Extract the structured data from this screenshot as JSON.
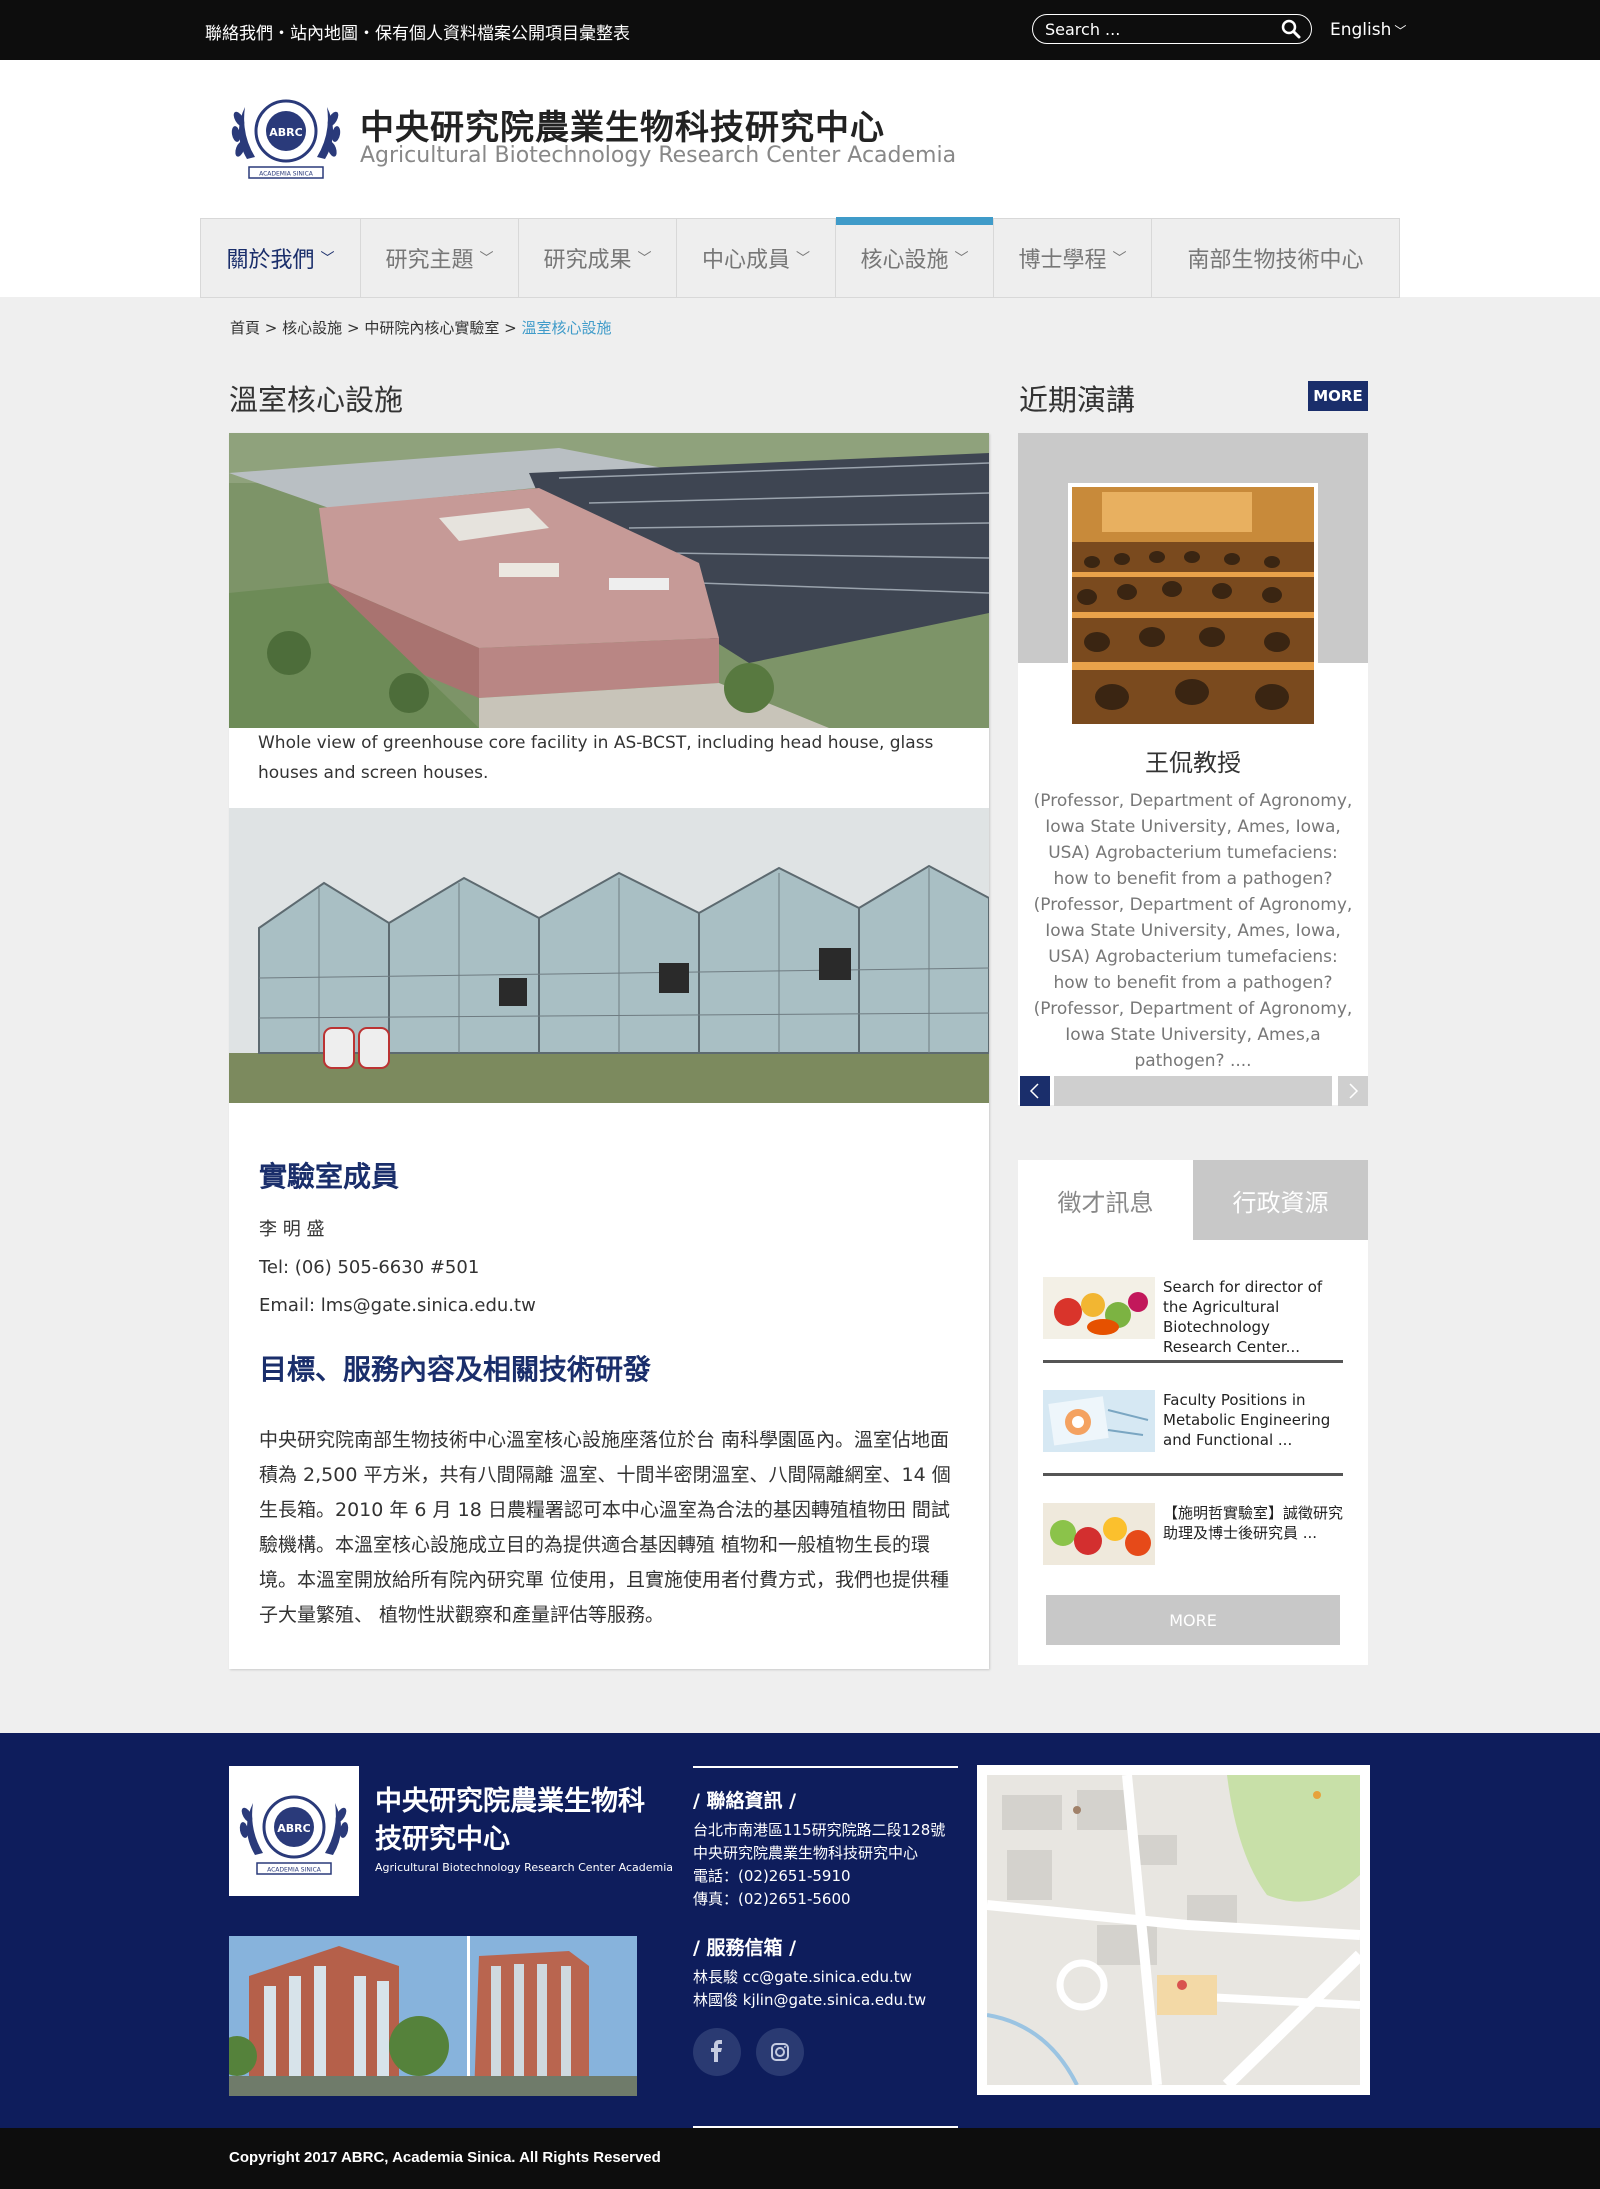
{
  "topbar": {
    "links": [
      "聯絡我們",
      "站內地圖",
      "保有個人資料檔案公開項目彙整表"
    ],
    "separator": "・",
    "search_placeholder": "Search ...",
    "language": "English"
  },
  "header": {
    "title_zh": "中央研究院農業生物科技研究中心",
    "title_en": "Agricultural Biotechnology Research Center Academia",
    "emblem_text": "ABRC",
    "emblem_ribbon": "ACADEMIA SINICA"
  },
  "nav": {
    "items": [
      {
        "label": "關於我們"
      },
      {
        "label": "研究主題"
      },
      {
        "label": "研究成果"
      },
      {
        "label": "中心成員"
      },
      {
        "label": "核心設施"
      },
      {
        "label": "博士學程"
      },
      {
        "label": "南部生物技術中心"
      }
    ],
    "chevron": "﹀"
  },
  "breadcrumb": {
    "items": [
      "首頁",
      "核心設施",
      "中研院內核心實驗室"
    ],
    "current": "溫室核心設施",
    "separator": ">"
  },
  "main": {
    "title": "溫室核心設施",
    "caption": "Whole view of greenhouse core facility in AS-BCST, including head house, glass houses and screen houses.",
    "members_heading": "實驗室成員",
    "member_name": "李 明 盛",
    "member_tel": "Tel: (06) 505-6630 #501",
    "member_email": "Email: lms@gate.sinica.edu.tw",
    "goals_heading": "目標、服務內容及相關技術研發",
    "goals_text": "中央研究院南部生物技術中心溫室核心設施座落位於台 南科學園區內。溫室佔地面積為 2,500 平方米，共有八間隔離 溫室、十間半密閉溫室、八間隔離網室、14 個生長箱。2010 年 6 月 18 日農糧署認可本中心溫室為合法的基因轉殖植物田 間試驗機構。本溫室核心設施成立目的為提供適合基因轉殖 植物和一般植物生長的環境。本溫室開放給所有院內研究單 位使用，且實施使用者付費方式，我們也提供種子大量繁殖、 植物性狀觀察和產量評估等服務。"
  },
  "talks": {
    "title": "近期演講",
    "more": "MORE",
    "speaker": "王侃教授",
    "description": "(Professor, Department of Agronomy, Iowa State University, Ames, Iowa, USA) Agrobacterium tumefaciens: how to benefit from a pathogen?  (Professor, Department of Agronomy, Iowa State University, Ames, Iowa, USA) Agrobacterium tumefaciens: how to benefit from a pathogen?  (Professor, Department of Agronomy, Iowa State University, Ames,a pathogen? ....",
    "prev_icon": "‹",
    "next_icon": "›"
  },
  "tabs": {
    "tab1": "徵才訊息",
    "tab2": "行政資源",
    "jobs": [
      {
        "text": "Search for director of the Agricultural Biotechnology Research Center..."
      },
      {
        "text": "Faculty Positions in Metabolic Engineering and Functional  ..."
      },
      {
        "text": "【施明哲實驗室】誠徵研究助理及博士後研究員 ..."
      }
    ],
    "more": "MORE"
  },
  "footer": {
    "title_zh": "中央研究院農業生物科技研究中心",
    "title_en": "Agricultural Biotechnology Research Center Academia",
    "contact_heading": "/ 聯絡資訊 /",
    "address": "台北市南港區115研究院路二段128號",
    "org": "中央研究院農業生物科技研究中心",
    "phone": "電話：(02)2651-5910",
    "fax": "傳真：(02)2651-5600",
    "mail_heading": "/ 服務信箱 /",
    "mail1": "林長駿  cc@gate.sinica.edu.tw",
    "mail2": "林國俊  kjlin@gate.sinica.edu.tw",
    "social": [
      "facebook-icon",
      "instagram-icon"
    ],
    "copyright": "Copyright 2017 ABRC, Academia Sinica. All Rights Reserved"
  },
  "colors": {
    "navy": "#1a2e6b",
    "accent": "#3f9bc9",
    "footer": "#0e1d5c"
  }
}
